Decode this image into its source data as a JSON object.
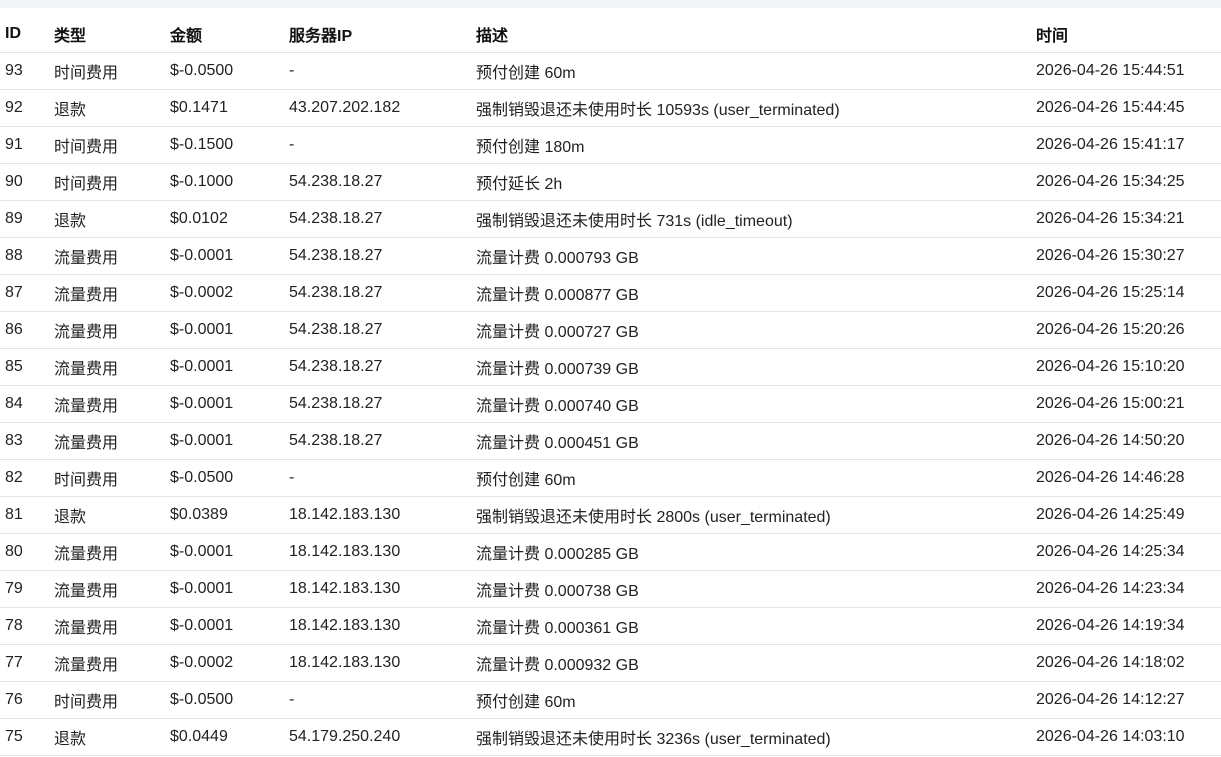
{
  "table": {
    "headers": {
      "id": "ID",
      "type": "类型",
      "amount": "金额",
      "ip": "服务器IP",
      "desc": "描述",
      "time": "时间"
    },
    "rows": [
      {
        "id": "93",
        "type": "时间费用",
        "amount": "$-0.0500",
        "ip": "-",
        "desc": "预付创建 60m",
        "time": "2026-04-26 15:44:51"
      },
      {
        "id": "92",
        "type": "退款",
        "amount": "$0.1471",
        "ip": "43.207.202.182",
        "desc": "强制销毁退还未使用时长 10593s (user_terminated)",
        "time": "2026-04-26 15:44:45"
      },
      {
        "id": "91",
        "type": "时间费用",
        "amount": "$-0.1500",
        "ip": "-",
        "desc": "预付创建 180m",
        "time": "2026-04-26 15:41:17"
      },
      {
        "id": "90",
        "type": "时间费用",
        "amount": "$-0.1000",
        "ip": "54.238.18.27",
        "desc": "预付延长 2h",
        "time": "2026-04-26 15:34:25"
      },
      {
        "id": "89",
        "type": "退款",
        "amount": "$0.0102",
        "ip": "54.238.18.27",
        "desc": "强制销毁退还未使用时长 731s (idle_timeout)",
        "time": "2026-04-26 15:34:21"
      },
      {
        "id": "88",
        "type": "流量费用",
        "amount": "$-0.0001",
        "ip": "54.238.18.27",
        "desc": "流量计费 0.000793 GB",
        "time": "2026-04-26 15:30:27"
      },
      {
        "id": "87",
        "type": "流量费用",
        "amount": "$-0.0002",
        "ip": "54.238.18.27",
        "desc": "流量计费 0.000877 GB",
        "time": "2026-04-26 15:25:14"
      },
      {
        "id": "86",
        "type": "流量费用",
        "amount": "$-0.0001",
        "ip": "54.238.18.27",
        "desc": "流量计费 0.000727 GB",
        "time": "2026-04-26 15:20:26"
      },
      {
        "id": "85",
        "type": "流量费用",
        "amount": "$-0.0001",
        "ip": "54.238.18.27",
        "desc": "流量计费 0.000739 GB",
        "time": "2026-04-26 15:10:20"
      },
      {
        "id": "84",
        "type": "流量费用",
        "amount": "$-0.0001",
        "ip": "54.238.18.27",
        "desc": "流量计费 0.000740 GB",
        "time": "2026-04-26 15:00:21"
      },
      {
        "id": "83",
        "type": "流量费用",
        "amount": "$-0.0001",
        "ip": "54.238.18.27",
        "desc": "流量计费 0.000451 GB",
        "time": "2026-04-26 14:50:20"
      },
      {
        "id": "82",
        "type": "时间费用",
        "amount": "$-0.0500",
        "ip": "-",
        "desc": "预付创建 60m",
        "time": "2026-04-26 14:46:28"
      },
      {
        "id": "81",
        "type": "退款",
        "amount": "$0.0389",
        "ip": "18.142.183.130",
        "desc": "强制销毁退还未使用时长 2800s (user_terminated)",
        "time": "2026-04-26 14:25:49"
      },
      {
        "id": "80",
        "type": "流量费用",
        "amount": "$-0.0001",
        "ip": "18.142.183.130",
        "desc": "流量计费 0.000285 GB",
        "time": "2026-04-26 14:25:34"
      },
      {
        "id": "79",
        "type": "流量费用",
        "amount": "$-0.0001",
        "ip": "18.142.183.130",
        "desc": "流量计费 0.000738 GB",
        "time": "2026-04-26 14:23:34"
      },
      {
        "id": "78",
        "type": "流量费用",
        "amount": "$-0.0001",
        "ip": "18.142.183.130",
        "desc": "流量计费 0.000361 GB",
        "time": "2026-04-26 14:19:34"
      },
      {
        "id": "77",
        "type": "流量费用",
        "amount": "$-0.0002",
        "ip": "18.142.183.130",
        "desc": "流量计费 0.000932 GB",
        "time": "2026-04-26 14:18:02"
      },
      {
        "id": "76",
        "type": "时间费用",
        "amount": "$-0.0500",
        "ip": "-",
        "desc": "预付创建 60m",
        "time": "2026-04-26 14:12:27"
      },
      {
        "id": "75",
        "type": "退款",
        "amount": "$0.0449",
        "ip": "54.179.250.240",
        "desc": "强制销毁退还未使用时长 3236s (user_terminated)",
        "time": "2026-04-26 14:03:10"
      }
    ]
  }
}
